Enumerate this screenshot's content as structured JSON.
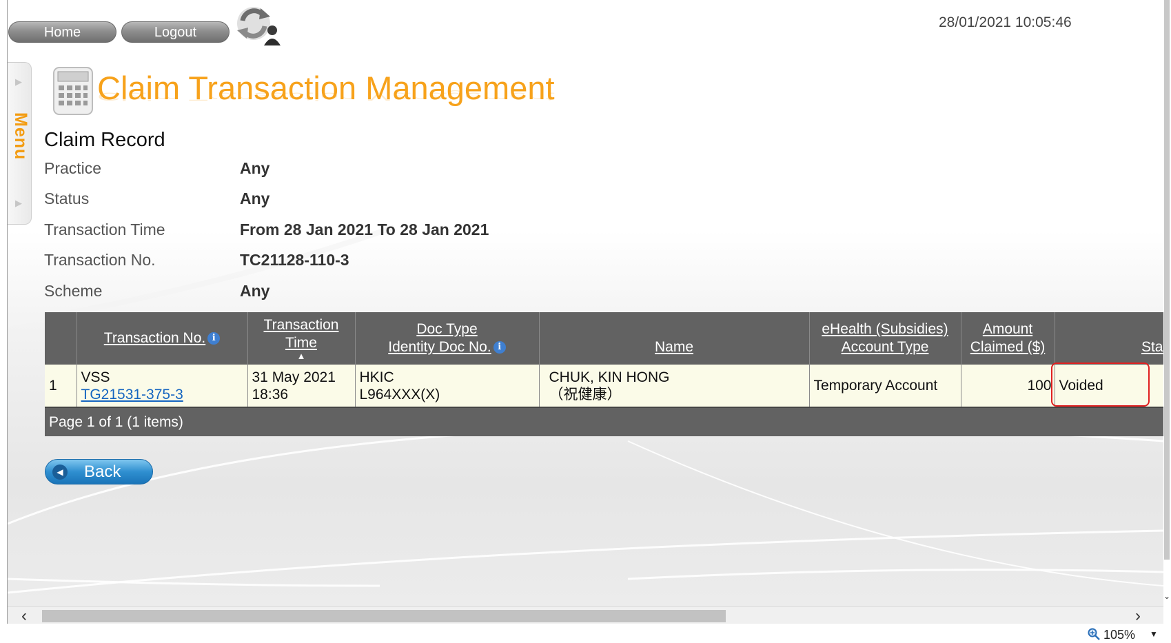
{
  "nav": {
    "home": "Home",
    "logout": "Logout"
  },
  "datetime": "28/01/2021 10:05:46",
  "menu_label": "Menu",
  "page_title": "Claim Transaction Management",
  "section_title": "Claim Record",
  "criteria": [
    {
      "label": "Practice",
      "value": "Any"
    },
    {
      "label": "Status",
      "value": "Any"
    },
    {
      "label": "Transaction Time",
      "value": "From 28 Jan 2021 To 28 Jan 2021"
    },
    {
      "label": "Transaction No.",
      "value": "TC21128-110-3"
    },
    {
      "label": "Scheme",
      "value": "Any"
    }
  ],
  "table": {
    "headers": {
      "transaction_no": "Transaction No.",
      "transaction_time_1": "Transaction",
      "transaction_time_2": "Time",
      "doc_type_1": "Doc Type",
      "doc_type_2": "Identity Doc No.",
      "name": "Name",
      "account_type_1": "eHealth (Subsidies)",
      "account_type_2": "Account Type",
      "amount_1": "Amount",
      "amount_2": "Claimed ($)",
      "status": "Sta"
    },
    "rows": [
      {
        "index": "1",
        "scheme": "VSS",
        "transaction_no": "TG21531-375-3",
        "date": "31 May 2021",
        "time": "18:36",
        "doc_type": "HKIC",
        "doc_no": "L964XXX(X)",
        "name_en": "CHUK, KIN HONG",
        "name_zh": "（祝健康）",
        "account_type": "Temporary Account",
        "amount": "100",
        "status": "Voided"
      }
    ],
    "pager": "Page 1 of 1 (1 items)"
  },
  "back_button": "Back",
  "zoom": "105%",
  "colors": {
    "title_orange": "#f7a21b",
    "menu_orange": "#f39c12",
    "grid_header": "#626262",
    "row_bg": "#fbfbe8",
    "link_blue": "#1565c0",
    "highlight_red": "#e02020",
    "back_blue": "#2f8fd0"
  }
}
